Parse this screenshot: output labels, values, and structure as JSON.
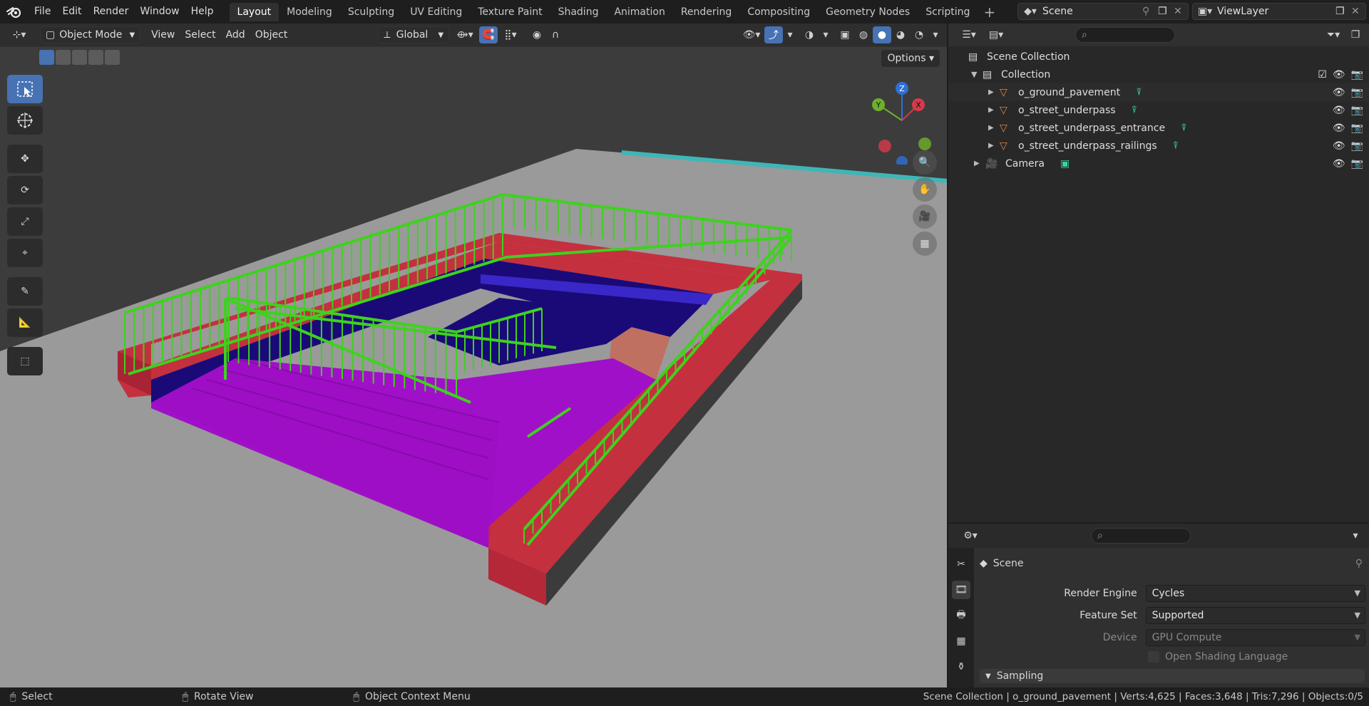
{
  "menu": {
    "items": [
      "File",
      "Edit",
      "Render",
      "Window",
      "Help"
    ]
  },
  "workspaces": {
    "tabs": [
      "Layout",
      "Modeling",
      "Sculpting",
      "UV Editing",
      "Texture Paint",
      "Shading",
      "Animation",
      "Rendering",
      "Compositing",
      "Geometry Nodes",
      "Scripting"
    ],
    "active": "Layout"
  },
  "scene": {
    "name": "Scene"
  },
  "view_layer": {
    "name": "ViewLayer"
  },
  "viewport": {
    "mode": "Object Mode",
    "menus": [
      "View",
      "Select",
      "Add",
      "Object"
    ],
    "orientation": "Global",
    "options_label": "Options",
    "gizmo_axes": {
      "z": "Z",
      "y": "Y",
      "x": "X"
    }
  },
  "outliner": {
    "root": "Scene Collection",
    "collection": "Collection",
    "objects": [
      "o_ground_pavement",
      "o_street_underpass",
      "o_street_underpass_entrance",
      "o_street_underpass_railings"
    ],
    "camera": "Camera"
  },
  "properties": {
    "context": "Scene",
    "render_engine_label": "Render Engine",
    "render_engine_value": "Cycles",
    "feature_set_label": "Feature Set",
    "feature_set_value": "Supported",
    "device_label": "Device",
    "device_value": "GPU Compute",
    "osl_label": "Open Shading Language",
    "sampling_label": "Sampling"
  },
  "statusbar": {
    "select": "Select",
    "rotate": "Rotate View",
    "context_menu": "Object Context Menu",
    "stats": "Scene Collection | o_ground_pavement | Verts:4,625 | Faces:3,648 | Tris:7,296 | Objects:0/5"
  },
  "colors": {
    "accent": "#4772b3",
    "railing": "#3fd11f",
    "curb": "#c5303f",
    "stairs": "#a010c8",
    "water_blue": "#1a0a78"
  }
}
